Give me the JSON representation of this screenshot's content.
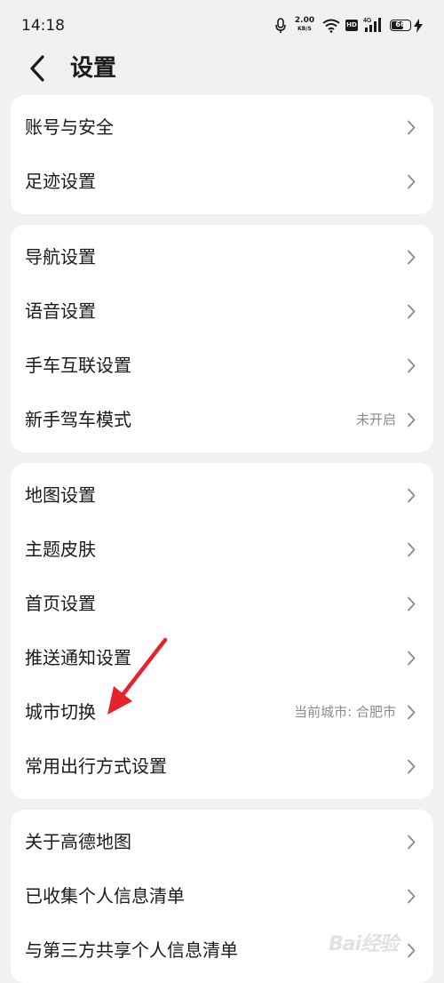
{
  "status_bar": {
    "time": "14:18",
    "net_speed_value": "2.00",
    "net_speed_unit": "KB/S",
    "hd_badge": "HD",
    "signal_label": "4G",
    "battery_level": "66"
  },
  "header": {
    "title": "设置"
  },
  "groups": [
    {
      "items": [
        {
          "label": "账号与安全",
          "value": ""
        },
        {
          "label": "足迹设置",
          "value": ""
        }
      ]
    },
    {
      "items": [
        {
          "label": "导航设置",
          "value": ""
        },
        {
          "label": "语音设置",
          "value": ""
        },
        {
          "label": "手车互联设置",
          "value": ""
        },
        {
          "label": "新手驾车模式",
          "value": "未开启"
        }
      ]
    },
    {
      "items": [
        {
          "label": "地图设置",
          "value": ""
        },
        {
          "label": "主题皮肤",
          "value": ""
        },
        {
          "label": "首页设置",
          "value": ""
        },
        {
          "label": "推送通知设置",
          "value": ""
        },
        {
          "label": "城市切换",
          "value": "当前城市: 合肥市"
        },
        {
          "label": "常用出行方式设置",
          "value": ""
        }
      ]
    },
    {
      "items": [
        {
          "label": "关于高德地图",
          "value": ""
        },
        {
          "label": "已收集个人信息清单",
          "value": ""
        },
        {
          "label": "与第三方共享个人信息清单",
          "value": ""
        }
      ]
    }
  ],
  "watermark": {
    "text": "Bai经验"
  },
  "colors": {
    "background": "#f1f1f3",
    "card": "#ffffff",
    "annotation_arrow": "#e5232b",
    "secondary_text": "#8c8c8c"
  },
  "icons": {
    "back": "chevron-left-icon",
    "row_chevron": "chevron-right-icon",
    "mic": "microphone-icon",
    "wifi": "wifi-icon",
    "signal": "cellular-signal-icon",
    "battery": "battery-icon",
    "charging": "lightning-icon"
  }
}
